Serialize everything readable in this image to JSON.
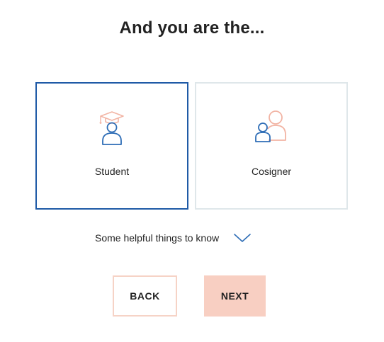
{
  "heading": "And you are the...",
  "options": [
    {
      "label": "Student",
      "icon": "student-graduate-icon",
      "selected": true
    },
    {
      "label": "Cosigner",
      "icon": "cosigner-people-icon",
      "selected": false
    }
  ],
  "helpful": {
    "label": "Some helpful things to know",
    "icon": "chevron-down-icon"
  },
  "buttons": {
    "back": "BACK",
    "next": "NEXT"
  },
  "colors": {
    "selected_border": "#1f5aa6",
    "unselected_border": "#dfe7ea",
    "icon_blue": "#2e6db6",
    "icon_peach": "#f2b4a4",
    "back_border": "#f6d3c6",
    "next_bg": "#f8cfc2"
  }
}
